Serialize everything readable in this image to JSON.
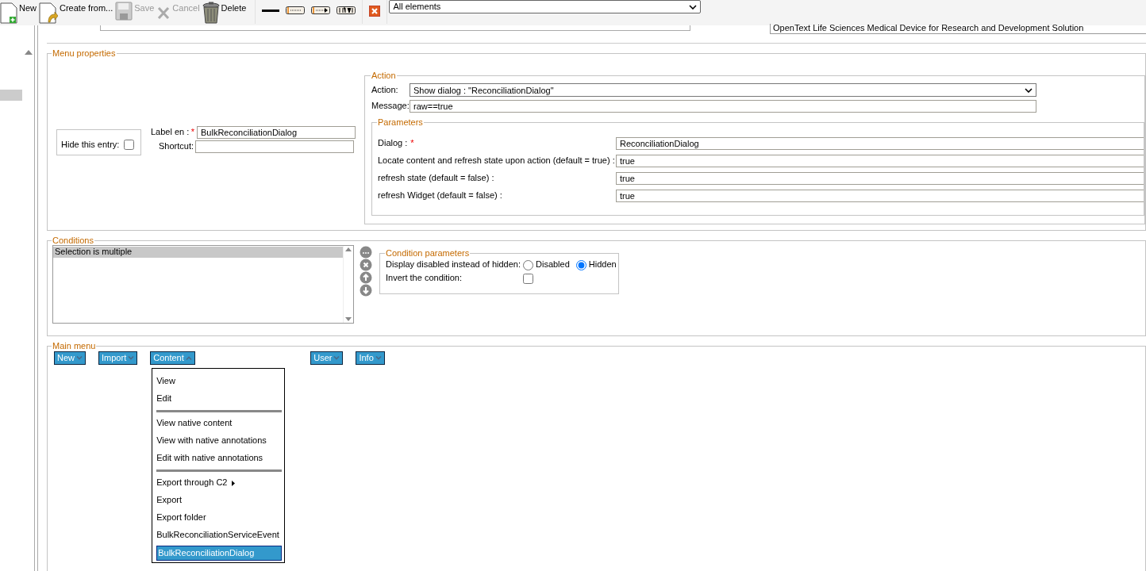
{
  "toolbar": {
    "buttons": [
      {
        "kind": "new",
        "label": "New",
        "disabled": false
      },
      {
        "kind": "create",
        "label": "Create from...",
        "disabled": false
      },
      {
        "kind": "save",
        "label": "Save",
        "disabled": true
      },
      {
        "kind": "cancel",
        "label": "Cancel",
        "disabled": true
      },
      {
        "kind": "delete",
        "label": "Delete",
        "disabled": false
      }
    ],
    "element_filter": "All elements"
  },
  "header": {
    "description": "OpenText Life Sciences Medical Device for Research and Development Solution"
  },
  "sidebar": {
    "items": [
      {
        "selected": true
      }
    ]
  },
  "menu_properties": {
    "title": "Menu properties",
    "hide_entry": {
      "label": "Hide this entry:",
      "checked": false
    },
    "label_field": {
      "label": "Label en :",
      "value": "BulkReconciliationDialog",
      "required_mark": "*"
    },
    "shortcut_field": {
      "label": "Shortcut:"
    },
    "action": {
      "title": "Action",
      "action_label": "Action:",
      "action_value": "Show dialog : \"ReconciliationDialog\"",
      "message_label": "Message:",
      "message_value": "raw==true",
      "parameters": {
        "title": "Parameters",
        "rows": [
          {
            "label": "Dialog :",
            "value": "ReconciliationDialog",
            "required_mark": "*"
          },
          {
            "label": "Locate content and refresh state upon action (default = true) :",
            "value": "true"
          },
          {
            "label": "refresh state (default = false) :",
            "value": "true"
          },
          {
            "label": "refresh Widget (default = false) :",
            "value": "true"
          }
        ]
      }
    }
  },
  "conditions": {
    "title": "Conditions",
    "items": [
      {
        "label": "Selection is multiple",
        "selected": true
      }
    ],
    "parameters": {
      "title": "Condition parameters",
      "display_label": "Display disabled instead of hidden:",
      "options": [
        {
          "label": "Disabled",
          "selected": false
        },
        {
          "label": "Hidden",
          "selected": true
        }
      ],
      "invert_label": "Invert the condition:",
      "invert_checked": false
    }
  },
  "main_menu": {
    "title": "Main menu",
    "menus": [
      {
        "label": "New",
        "expanded": false
      },
      {
        "label": "Import",
        "expanded": false
      },
      {
        "label": "Content",
        "expanded": true
      },
      {
        "label": "User",
        "expanded": false
      },
      {
        "label": "Info",
        "expanded": false
      }
    ],
    "dropdown": [
      {
        "kind": "item",
        "label": "View",
        "selected": false
      },
      {
        "kind": "item",
        "label": "Edit",
        "selected": false
      },
      {
        "kind": "separator"
      },
      {
        "kind": "item",
        "label": "View native content",
        "selected": false
      },
      {
        "kind": "item",
        "label": "View with native annotations",
        "selected": false
      },
      {
        "kind": "item",
        "label": "Edit with native annotations",
        "selected": false
      },
      {
        "kind": "separator"
      },
      {
        "kind": "submenu",
        "label": "Export through C2",
        "selected": false
      },
      {
        "kind": "item",
        "label": "Export",
        "selected": false
      },
      {
        "kind": "item",
        "label": "Export folder",
        "selected": false
      },
      {
        "kind": "item",
        "label": "BulkReconciliationServiceEvent",
        "selected": false
      },
      {
        "kind": "item",
        "label": "BulkReconciliationDialog",
        "selected": true
      }
    ]
  }
}
